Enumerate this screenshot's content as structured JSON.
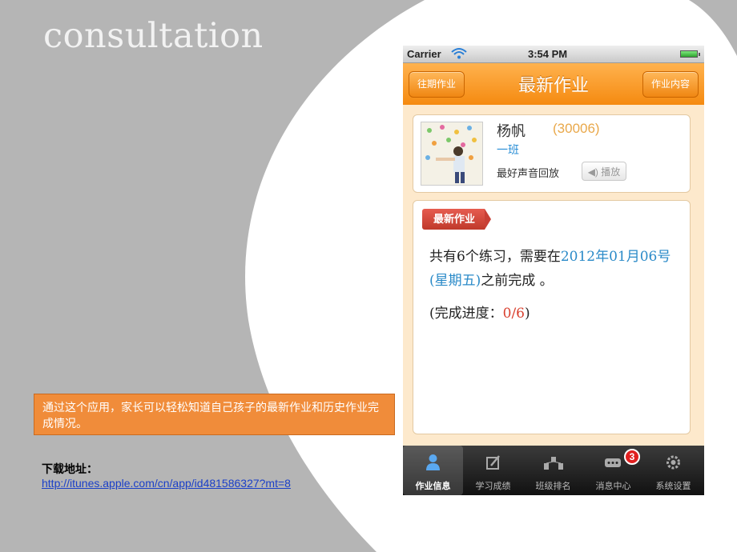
{
  "slide": {
    "title": "consultation",
    "callout": "通过这个应用，家长可以轻松知道自己孩子的最新作业和历史作业完成情况。",
    "download_label": "下载地址：",
    "download_url": "http://itunes.apple.com/cn/app/id481586327?mt=8"
  },
  "status_bar": {
    "carrier": "Carrier",
    "time": "3:54 PM"
  },
  "nav": {
    "left_button": "往期作业",
    "title": "最新作业",
    "right_button": "作业内容"
  },
  "profile": {
    "name": "杨帆",
    "id": "(30006)",
    "class": "一班",
    "best_voice_label": "最好声音回放",
    "play_button": "播放"
  },
  "homework": {
    "tag": "最新作业",
    "text_prefix": "共有6个练习，需要在",
    "due_date": "2012年01月06号(星期五)",
    "text_suffix": "之前完成 。",
    "progress_label": "(完成进度：",
    "progress_value": "0/6",
    "progress_close": ")"
  },
  "tabbar": {
    "tabs": [
      {
        "label": "作业信息",
        "icon": "person-icon"
      },
      {
        "label": "学习成绩",
        "icon": "edit-icon"
      },
      {
        "label": "班级排名",
        "icon": "ranking-icon"
      },
      {
        "label": "消息中心",
        "icon": "message-icon"
      },
      {
        "label": "系统设置",
        "icon": "gear-icon"
      }
    ],
    "message_badge": "3"
  },
  "colors": {
    "accent": "#f58a10",
    "callout": "#f08c3a",
    "tag": "#c0392b",
    "link": "#1a3fc8"
  }
}
